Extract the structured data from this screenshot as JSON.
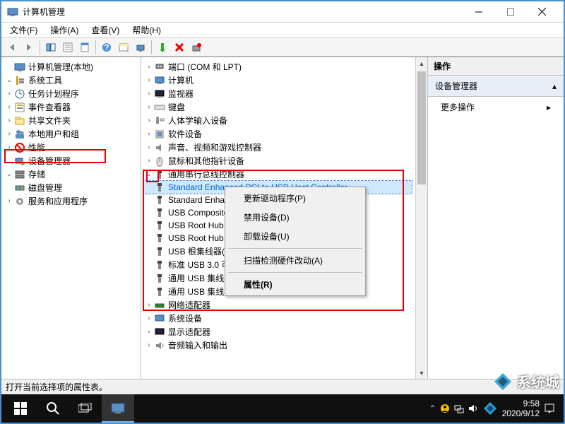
{
  "window": {
    "title": "计算机管理"
  },
  "menus": {
    "file": "文件(F)",
    "action": "操作(A)",
    "view": "查看(V)",
    "help": "帮助(H)"
  },
  "left_tree": {
    "root": "计算机管理(本地)",
    "sys_tools": "系统工具",
    "task_sched": "任务计划程序",
    "event_viewer": "事件查看器",
    "shared_folders": "共享文件夹",
    "local_users": "本地用户和组",
    "performance": "性能",
    "device_mgr": "设备管理器",
    "storage": "存储",
    "disk_mgmt": "磁盘管理",
    "services_apps": "服务和应用程序"
  },
  "mid_tree": {
    "ports": "端口 (COM 和 LPT)",
    "computer": "计算机",
    "monitor": "监视器",
    "keyboard": "键盘",
    "hid": "人体学输入设备",
    "software_dev": "软件设备",
    "sound": "声音、视频和游戏控制器",
    "mouse": "鼠标和其他指针设备",
    "usb_ctrl": "通用串行总线控制器",
    "usb_items": [
      "Standard Enhanced PCI to USB Host Controller",
      "Standard Enhanced PCI to USB Host Controller",
      "USB Composite Device",
      "USB Root Hub",
      "USB Root Hub",
      "USB 根集线器(USB 3.0)",
      "标准 USB 3.0 可扩展主机控制器 - 1.0 (Microsoft)",
      "通用 USB 集线器",
      "通用 USB 集线器"
    ],
    "net_adapter": "网络适配器",
    "sys_dev": "系统设备",
    "display": "显示适配器",
    "audio_io": "音频输入和输出"
  },
  "ctx": {
    "update_driver": "更新驱动程序(P)",
    "disable": "禁用设备(D)",
    "uninstall": "卸载设备(U)",
    "scan_hw": "扫描检测硬件改动(A)",
    "properties": "属性(R)"
  },
  "right": {
    "header": "操作",
    "section": "设备管理器",
    "more": "更多操作"
  },
  "status": "打开当前选择项的属性表。",
  "taskbar": {
    "time": "9:58",
    "date": "2020/9/12"
  },
  "watermark": "系统城"
}
